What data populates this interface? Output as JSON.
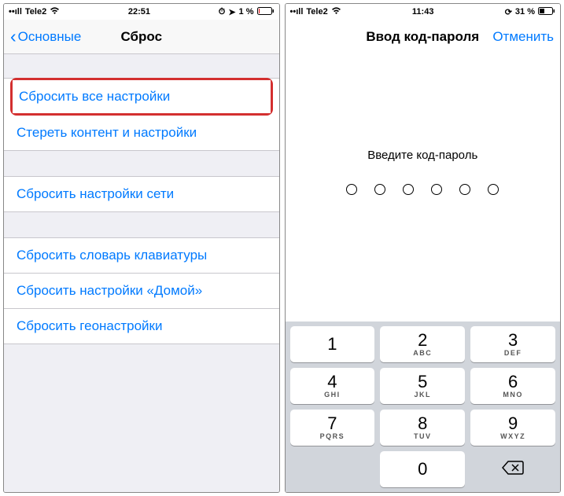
{
  "left": {
    "status": {
      "carrier": "Tele2",
      "time": "22:51",
      "battery": "1 %"
    },
    "nav": {
      "back": "Основные",
      "title": "Сброс"
    },
    "groups": [
      [
        "Сбросить все настройки",
        "Стереть контент и настройки"
      ],
      [
        "Сбросить настройки сети"
      ],
      [
        "Сбросить словарь клавиатуры",
        "Сбросить настройки «Домой»",
        "Сбросить геонастройки"
      ]
    ]
  },
  "right": {
    "status": {
      "carrier": "Tele2",
      "time": "11:43",
      "battery": "31 %"
    },
    "nav": {
      "title": "Ввод код-пароля",
      "cancel": "Отменить"
    },
    "prompt": "Введите код-пароль",
    "keypad": [
      {
        "digit": "1",
        "letters": ""
      },
      {
        "digit": "2",
        "letters": "ABC"
      },
      {
        "digit": "3",
        "letters": "DEF"
      },
      {
        "digit": "4",
        "letters": "GHI"
      },
      {
        "digit": "5",
        "letters": "JKL"
      },
      {
        "digit": "6",
        "letters": "MNO"
      },
      {
        "digit": "7",
        "letters": "PQRS"
      },
      {
        "digit": "8",
        "letters": "TUV"
      },
      {
        "digit": "9",
        "letters": "WXYZ"
      },
      {
        "digit": "0",
        "letters": ""
      }
    ]
  }
}
